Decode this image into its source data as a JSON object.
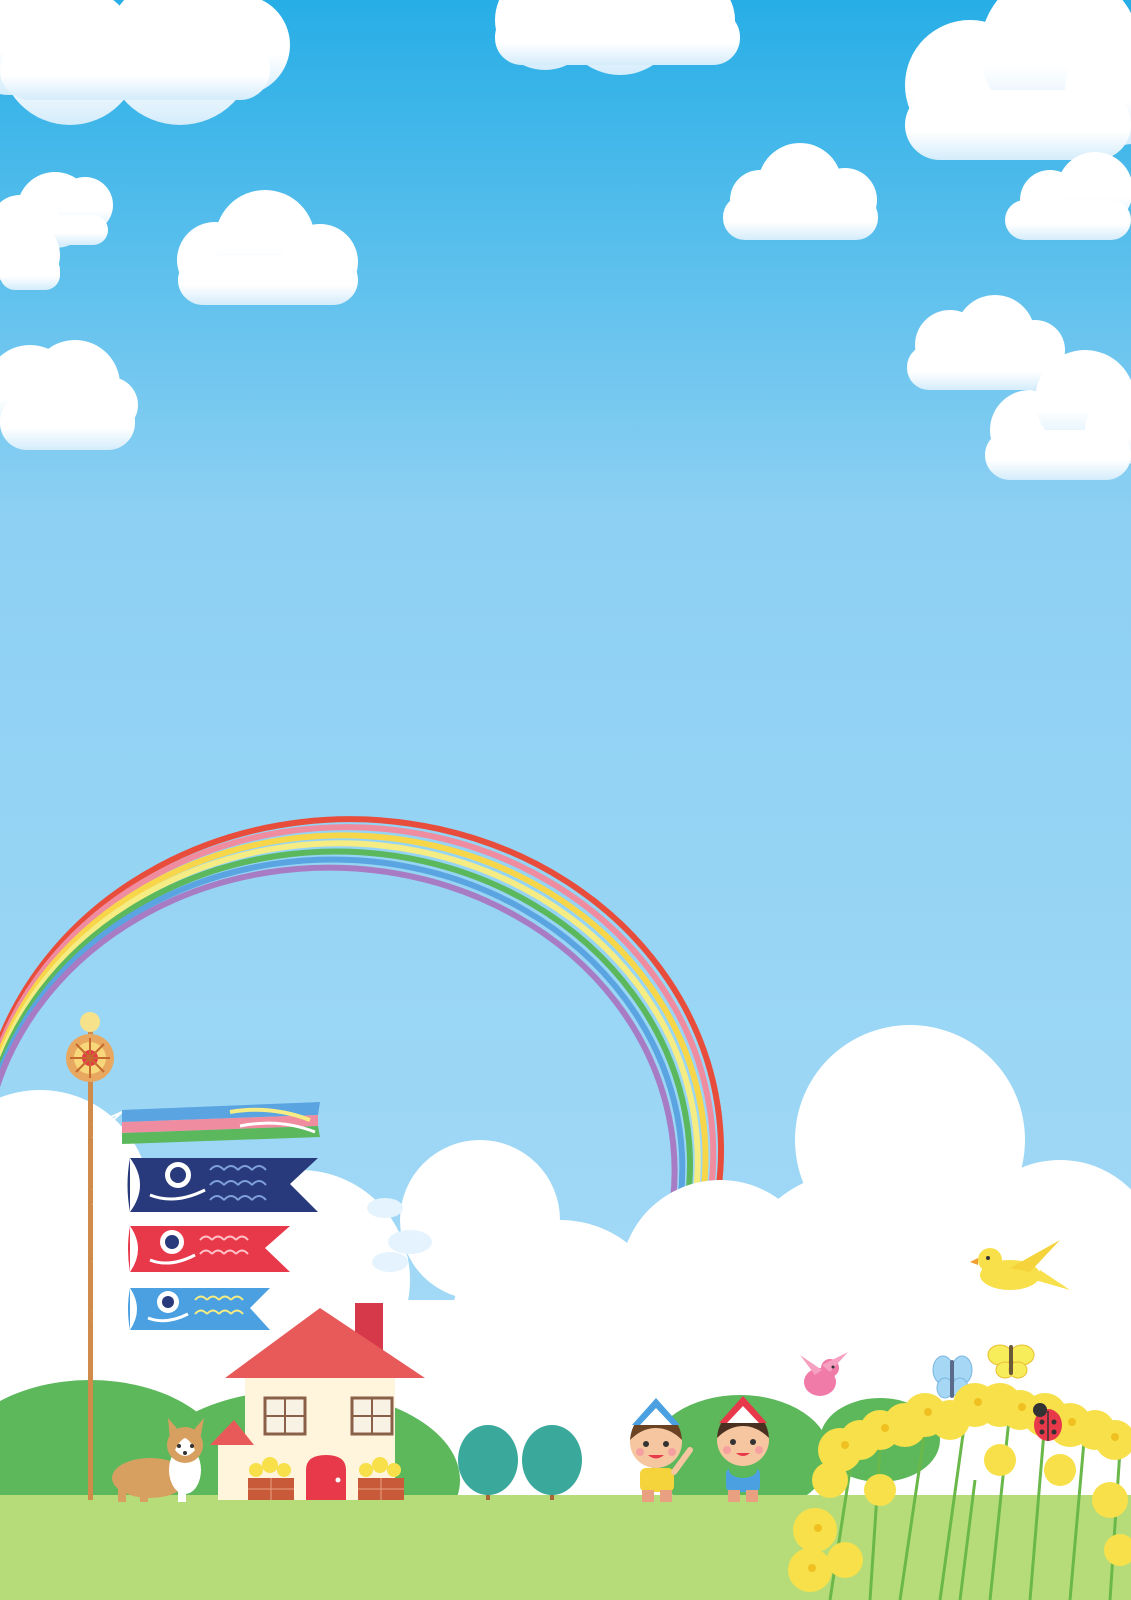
{
  "scene": {
    "colors": {
      "sky_top": "#27aee6",
      "sky_mid": "#8dd0f3",
      "sky_bottom": "#a9dcf7",
      "cloud": "#ffffff",
      "cloud_shade": "#dff1fc",
      "hill": "#5db85c",
      "ground": "#b6dc79",
      "rainbow": [
        "#e84d3c",
        "#f08ca0",
        "#f7d64a",
        "#f5ec84",
        "#5bb85d",
        "#5aa5e1",
        "#a77cc4"
      ],
      "house_roof": "#e85a5a",
      "house_wall": "#fff5dc",
      "koi_black": "#283a7c",
      "koi_red": "#e8394a",
      "koi_blue": "#4aa0e0",
      "canola": "#f7e04a"
    },
    "icons": {
      "pole": "koinobori-pole-icon",
      "streamer": "fukinagashi-streamer-icon",
      "black_koi": "black-koi-icon",
      "red_koi": "red-koi-icon",
      "blue_koi": "blue-koi-icon",
      "house": "house-icon",
      "dog": "corgi-dog-icon",
      "boy_left": "boy-with-kabuto-hat-icon",
      "boy_right": "boy-with-kashiwa-mochi-icon",
      "yellow_bird": "yellow-bird-icon",
      "pink_bird": "pink-bird-icon",
      "blue_butterfly": "blue-butterfly-icon",
      "yellow_butterfly": "yellow-butterfly-icon",
      "ladybug": "ladybug-icon",
      "canola": "canola-flowers-icon",
      "trees": "round-tree-icon",
      "rainbow": "rainbow-icon"
    }
  }
}
